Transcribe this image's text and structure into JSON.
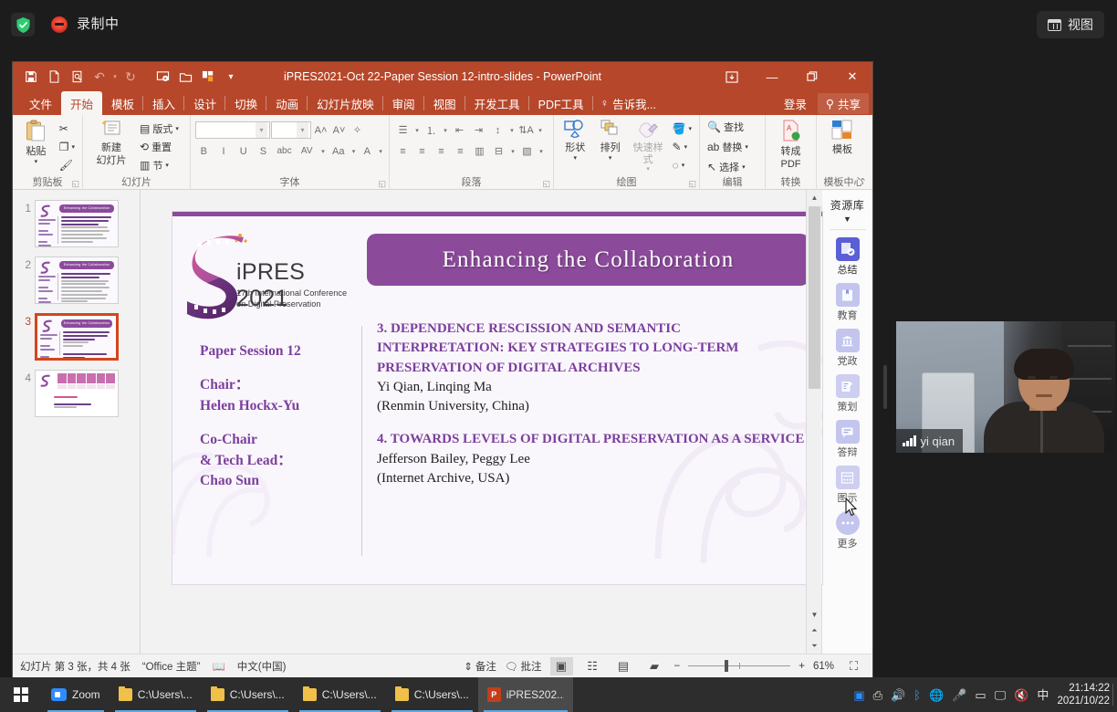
{
  "recorder": {
    "shield_icon": "shield-check-icon",
    "rec_icon": "record-stop-icon",
    "rec_label": "录制中",
    "view_label": "视图",
    "view_icon": "grid-view-icon"
  },
  "powerpoint": {
    "title": "iPRES2021-Oct 22-Paper Session 12-intro-slides - PowerPoint",
    "quick_access": [
      {
        "name": "save-icon",
        "glyph": "💾"
      },
      {
        "name": "new-file-icon",
        "glyph": "📄"
      },
      {
        "name": "print-preview-icon",
        "glyph": "🔍"
      },
      {
        "name": "undo-icon",
        "glyph": "↶"
      },
      {
        "name": "redo-icon",
        "glyph": "↻"
      },
      {
        "name": "start-slideshow-icon",
        "glyph": "▷"
      },
      {
        "name": "open-folder-icon",
        "glyph": "📁"
      },
      {
        "name": "templates-icon",
        "glyph": "■"
      },
      {
        "name": "customize-qat-icon",
        "glyph": "≡"
      }
    ],
    "window_controls": [
      {
        "name": "ribbon-display-options",
        "glyph": "⬜"
      },
      {
        "name": "minimize-button",
        "glyph": "─"
      },
      {
        "name": "restore-button",
        "glyph": "❐"
      },
      {
        "name": "close-button",
        "glyph": "✕"
      }
    ],
    "tabs": [
      {
        "label": "文件",
        "active": false
      },
      {
        "label": "开始",
        "active": true
      },
      {
        "label": "模板",
        "active": false
      },
      {
        "label": "插入",
        "active": false
      },
      {
        "label": "设计",
        "active": false
      },
      {
        "label": "切换",
        "active": false
      },
      {
        "label": "动画",
        "active": false
      },
      {
        "label": "幻灯片放映",
        "active": false
      },
      {
        "label": "审阅",
        "active": false
      },
      {
        "label": "视图",
        "active": false
      },
      {
        "label": "开发工具",
        "active": false
      },
      {
        "label": "PDF工具",
        "active": false
      }
    ],
    "tell_me": "告诉我...",
    "sign_in": "登录",
    "share": "共享",
    "ribbon": {
      "clipboard": {
        "group_label": "剪贴板",
        "paste_label": "粘贴",
        "cut_label": "剪切",
        "copy_label": "复制",
        "format_painter_label": "格式刷"
      },
      "slides": {
        "group_label": "幻灯片",
        "new_slide_line1": "新建",
        "new_slide_line2": "幻灯片",
        "layout_label": "版式",
        "reset_label": "重置",
        "section_label": "节"
      },
      "font": {
        "group_label": "字体",
        "font_name_value": "",
        "font_size_value": "",
        "bold": "B",
        "italic": "I",
        "underline": "U",
        "shadow": "S",
        "strikethrough": "abc",
        "spacing": "AV",
        "case": "Aa",
        "color": "A"
      },
      "paragraph": {
        "group_label": "段落"
      },
      "drawing": {
        "group_label": "绘图",
        "shapes_label": "形状",
        "arrange_label": "排列",
        "quick_styles_label": "快速样式"
      },
      "editing": {
        "group_label": "编辑",
        "find_label": "查找",
        "replace_label": "替换",
        "select_label": "选择"
      },
      "convert": {
        "group_label": "转换",
        "topdf_line1": "转成",
        "topdf_line2": "PDF"
      },
      "template_center": {
        "group_label": "模板中心",
        "template_label": "模板"
      }
    },
    "thumbnails": [
      {
        "number": "1",
        "selected": false
      },
      {
        "number": "2",
        "selected": false
      },
      {
        "number": "3",
        "selected": true
      },
      {
        "number": "4",
        "selected": false
      }
    ],
    "slide": {
      "banner_title": "Enhancing the Collaboration",
      "logo_name": "iPRES 2021",
      "logo_sub_line1": "17th International Conference",
      "logo_sub_line2": "on Digital Preservation",
      "left_column": {
        "session": "Paper Session 12",
        "chair_label": "Chair：",
        "chair_name": "Helen Hockx-Yu",
        "cochair_label1": "Co-Chair",
        "cochair_label2": "& Tech Lead：",
        "cochair_name": "Chao Sun"
      },
      "papers": [
        {
          "title": "3.   DEPENDENCE RESCISSION AND SEMANTIC INTERPRETATION: KEY STRATEGIES TO LONG-TERM PRESERVATION OF DIGITAL ARCHIVES",
          "authors": "Yi Qian, Linqing Ma",
          "affiliation": "(Renmin University, China)"
        },
        {
          "title": "4.   TOWARDS LEVELS OF DIGITAL PRESERVATION AS A SERVICE",
          "authors": "Jefferson Bailey, Peggy Lee",
          "affiliation": "(Internet Archive, USA)"
        }
      ]
    },
    "resource_panel": {
      "title": "资源库",
      "items": [
        {
          "label": "总结",
          "icon": "summary-icon",
          "color": "#5b5fd6"
        },
        {
          "label": "教育",
          "icon": "education-book-icon",
          "color": "#c3c5ee"
        },
        {
          "label": "党政",
          "icon": "government-icon",
          "color": "#c3c5ee"
        },
        {
          "label": "策划",
          "icon": "planning-icon",
          "color": "#cdcef0"
        },
        {
          "label": "答辩",
          "icon": "defense-icon",
          "color": "#c3c5ee"
        },
        {
          "label": "图示",
          "icon": "diagram-icon",
          "color": "#cdcef0"
        },
        {
          "label": "更多",
          "icon": "more-dots-icon",
          "color": "#c3c5ee"
        }
      ]
    },
    "statusbar": {
      "slide_count": "幻灯片 第 3 张，共 4 张",
      "theme": "“Office 主题”",
      "proofing_icon": "proofing-icon",
      "language": "中文(中国)",
      "notes_label": "备注",
      "comments_label": "批注",
      "views": [
        {
          "name": "normal-view-button",
          "glyph": "▣",
          "active": true
        },
        {
          "name": "slide-sorter-button",
          "glyph": "☷",
          "active": false
        },
        {
          "name": "reading-view-button",
          "glyph": "▤",
          "active": false
        },
        {
          "name": "slideshow-button",
          "glyph": "▰",
          "active": false
        }
      ],
      "zoom_out": "−",
      "zoom_in": "+",
      "zoom_level": "61%",
      "fit_icon": "fit-to-window-icon"
    }
  },
  "video": {
    "participant_name": "yi qian",
    "signal_icon": "signal-bars-icon"
  },
  "taskbar": {
    "start_icon": "windows-start-icon",
    "apps": [
      {
        "label": "Zoom",
        "icon": "zoom-icon"
      },
      {
        "label": "C:\\Users\\...",
        "icon": "folder-icon"
      },
      {
        "label": "C:\\Users\\...",
        "icon": "folder-icon"
      },
      {
        "label": "C:\\Users\\...",
        "icon": "folder-icon"
      },
      {
        "label": "C:\\Users\\...",
        "icon": "folder-icon"
      },
      {
        "label": "iPRES202...",
        "icon": "powerpoint-icon",
        "active": true
      }
    ],
    "tray": [
      {
        "name": "zoom-tray-icon",
        "glyph": "▣"
      },
      {
        "name": "usb-eject-icon",
        "glyph": "⛁"
      },
      {
        "name": "volume-alert-icon",
        "glyph": "🔊"
      },
      {
        "name": "bluetooth-icon",
        "glyph": "ᛦ"
      },
      {
        "name": "network-globe-icon",
        "glyph": "🌐"
      },
      {
        "name": "microphone-icon",
        "glyph": "🎤"
      },
      {
        "name": "battery-icon",
        "glyph": "▭"
      },
      {
        "name": "display-icon",
        "glyph": "🖵"
      },
      {
        "name": "volume-muted-icon",
        "glyph": "🔇"
      },
      {
        "name": "ime-chinese-icon",
        "glyph": "中"
      }
    ],
    "time": "21:14:22",
    "date": "2021/10/22"
  },
  "colors": {
    "ppt_red": "#b7472a",
    "slide_purple": "#8c4a9b",
    "title_purple": "#7b3f9d",
    "selection_orange": "#d4451d"
  }
}
